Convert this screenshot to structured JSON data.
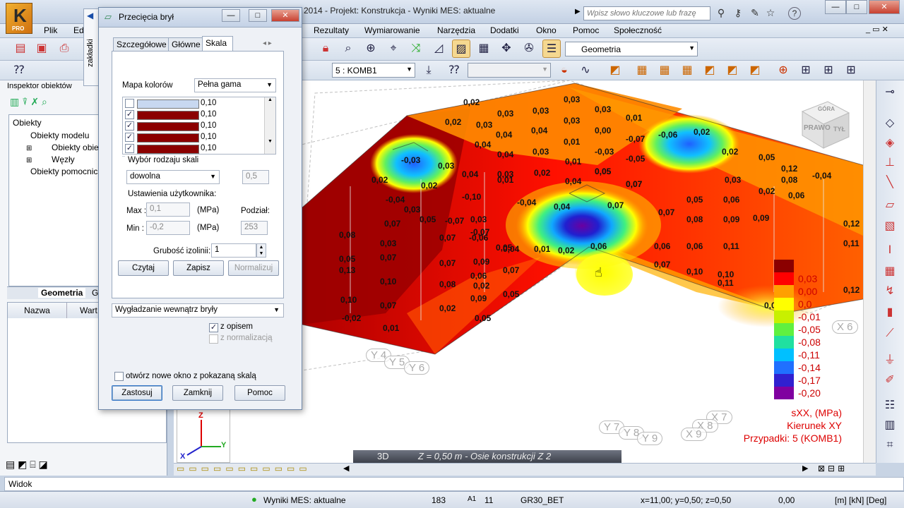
{
  "titlebar": {
    "title": "l 2014 - Projekt: Konstrukcja - Wyniki MES: aktualne",
    "logo_label": "PRO",
    "search_placeholder": "Wpisz słowo kluczowe lub frazę",
    "window_controls": {
      "minimize": "—",
      "maximize": "□",
      "close": "✕"
    }
  },
  "menu": {
    "items": [
      "Plik",
      "Ed",
      "Rezultaty",
      "Wymiarowanie",
      "Narzędzia",
      "Dodatki",
      "Okno",
      "Pomoc",
      "Społeczność"
    ]
  },
  "toolbar": {
    "geometry_combo": "Geometria",
    "case_combo": "5 : KOMB1"
  },
  "side_tab": "zakładki",
  "left_panel": {
    "title": "Inspektor obiektów",
    "tree_header": "Obiekty",
    "tree": [
      {
        "label": "Obiekty modelu",
        "indent": 1
      },
      {
        "label": "Obiekty obiet",
        "indent": 2
      },
      {
        "label": "Węzły",
        "indent": 2
      },
      {
        "label": "Obiekty pomocnicze",
        "indent": 1
      }
    ],
    "bottom_tabs": [
      "Geometria",
      "G"
    ],
    "prop_headers": [
      "Nazwa",
      "Wart"
    ]
  },
  "dialog": {
    "title": "Przecięcia brył",
    "tabs": [
      "Szczegółowe",
      "Główne",
      "Skala"
    ],
    "active_tab": "Skala",
    "color_map_label": "Mapa kolorów",
    "color_map_value": "Pełna gama",
    "color_rows": [
      {
        "checked": false,
        "color": "#c8d8f0",
        "value": "0,10"
      },
      {
        "checked": true,
        "color": "#8b0000",
        "value": "0,10"
      },
      {
        "checked": true,
        "color": "#8b0000",
        "value": "0,10"
      },
      {
        "checked": true,
        "color": "#8b0000",
        "value": "0,10"
      },
      {
        "checked": true,
        "color": "#8b0000",
        "value": "0,10"
      }
    ],
    "scale_type_label": "Wybór rodzaju skali",
    "scale_type_value": "dowolna",
    "scale_type_number": "0,5",
    "user_settings_label": "Ustawienia użytkownika:",
    "max_label": "Max :",
    "max_value": "0,1",
    "min_label": "Min :",
    "min_value": "-0,2",
    "unit": "(MPa)",
    "division_label": "Podział:",
    "division_value": "253",
    "line_thickness_label": "Grubość izolinii:",
    "line_thickness_value": "1",
    "buttons": {
      "read": "Czytaj",
      "save": "Zapisz",
      "normalize": "Normalizuj"
    },
    "smoothing_value": "Wygładzanie wewnątrz bryły",
    "with_description": "z opisem",
    "with_normalization": "z normalizacją",
    "open_new_window": "otwórz nowe okno z pokazaną skalą",
    "footer": {
      "apply": "Zastosuj",
      "close": "Zamknij",
      "help": "Pomoc"
    }
  },
  "viewport": {
    "nav_cube_labels": [
      "PRAWO",
      "TYŁ",
      "GÓRA"
    ],
    "status_mode": "3D",
    "status_text": "Z = 0,50 m - Osie konstrukcji Z 2",
    "axis_labels": [
      "Y 4",
      "Y 5",
      "Y 6",
      "Y 7",
      "Y 8",
      "Y 9",
      "X 6",
      "X 7",
      "X 8",
      "X 9"
    ],
    "values": [
      "0,02",
      "0,03",
      "0,03",
      "0,03",
      "0,03",
      "0,01",
      "0,02",
      "0,03",
      "0,04",
      "0,04",
      "0,03",
      "0,00",
      "-0,07",
      "-0,06",
      "0,02",
      "0,04",
      "0,04",
      "0,03",
      "0,01",
      "-0,03",
      "-0,05",
      "0,02",
      "0,05",
      "0,12",
      "-0,03",
      "0,03",
      "0,04",
      "0,03",
      "0,02",
      "0,01",
      "0,05",
      "0,07",
      "0,08",
      "-0,04",
      "0,02",
      "0,02",
      "0,01",
      "0,04",
      "0,05",
      "0,07",
      "0,03",
      "0,02",
      "-0,04",
      "-0,10",
      "-0,04",
      "0,04",
      "0,07",
      "0,05",
      "0,06",
      "0,06",
      "0,03",
      "-0,07",
      "0,03",
      "0,01",
      "0,05",
      "0,07",
      "0,08",
      "0,09",
      "0,09",
      "0,07",
      "0,05",
      "-0,07",
      "-0,06",
      "0,02",
      "0,06",
      "0,06",
      "0,06",
      "0,11",
      "0,12",
      "0,08",
      "0,03",
      "0,07",
      "0,04",
      "0,07",
      "0,07",
      "0,10",
      "0,10",
      "0,05",
      "0,07",
      "0,07",
      "0,06",
      "0,02",
      "0,11",
      "0,12",
      "0,13",
      "0,10",
      "0,08",
      "0,09",
      "0,09",
      "0,11",
      "0,10",
      "0,07",
      "0,02",
      "0,05",
      "0,05",
      "0,05",
      "-0,02",
      "0,01"
    ],
    "legend": {
      "rows": [
        {
          "color": "#8b0000",
          "value": ""
        },
        {
          "color": "#ff0000",
          "value": "0,03"
        },
        {
          "color": "#ffa000",
          "value": "0,00"
        },
        {
          "color": "#ffff00",
          "value": "0,0"
        },
        {
          "color": "#c8f000",
          "value": "-0,01"
        },
        {
          "color": "#60f040",
          "value": "-0,05"
        },
        {
          "color": "#20e0a0",
          "value": "-0,08"
        },
        {
          "color": "#00c0ff",
          "value": "-0,11"
        },
        {
          "color": "#2070ff",
          "value": "-0,14"
        },
        {
          "color": "#3020d0",
          "value": "-0,17"
        },
        {
          "color": "#8000a0",
          "value": "-0,20"
        }
      ],
      "caption_1": "sXX, (MPa)",
      "caption_2": "Kierunek XY",
      "caption_3": "Przypadki: 5 (KOMB1)"
    },
    "triad": {
      "x": "X",
      "y": "Y",
      "z": "Z"
    }
  },
  "bottom": {
    "view_label": "Widok"
  },
  "statusbar": {
    "results": "Wyniki MES: aktualne",
    "count": "183",
    "section_num": "11",
    "material": "GR30_BET",
    "coords": "x=11,00; y=0,50; z=0,50",
    "angle": "0,00",
    "units": "[m] [kN] [Deg]"
  }
}
